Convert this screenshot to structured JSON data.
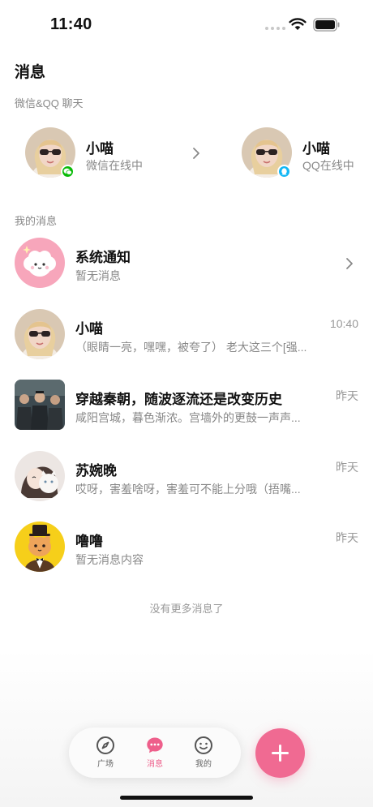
{
  "status": {
    "time": "11:40"
  },
  "header": {
    "title": "消息"
  },
  "wechat_qq": {
    "section_label": "微信&QQ 聊天",
    "contacts": [
      {
        "name": "小喵",
        "status": "微信在线中",
        "platform": "wechat",
        "badge_color": "#09bb07"
      },
      {
        "name": "小喵",
        "status": "QQ在线中",
        "platform": "qq",
        "badge_color": "#12b7f5"
      }
    ]
  },
  "messages": {
    "section_label": "我的消息",
    "items": [
      {
        "name": "系统通知",
        "preview": "暂无消息",
        "time": ""
      },
      {
        "name": "小喵",
        "preview": "（眼睛一亮，嘿嘿，被夸了） 老大这三个[强...",
        "time": "10:40"
      },
      {
        "name": "穿越秦朝，随波逐流还是改变历史",
        "preview": "咸阳宫城，暮色渐浓。宫墙外的更鼓一声声...",
        "time": "昨天"
      },
      {
        "name": "苏婉晚",
        "preview": "哎呀，害羞啥呀，害羞可不能上分哦（捂嘴...",
        "time": "昨天"
      },
      {
        "name": "噜噜",
        "preview": "暂无消息内容",
        "time": "昨天"
      }
    ],
    "end_text": "没有更多消息了"
  },
  "tabbar": {
    "tabs": [
      {
        "label": "广场",
        "icon": "compass-icon"
      },
      {
        "label": "消息",
        "icon": "chat-bubble-icon",
        "active": true
      },
      {
        "label": "我的",
        "icon": "smiley-face-icon"
      }
    ],
    "add_icon": "plus-icon",
    "accent": "#ee5f8b"
  }
}
